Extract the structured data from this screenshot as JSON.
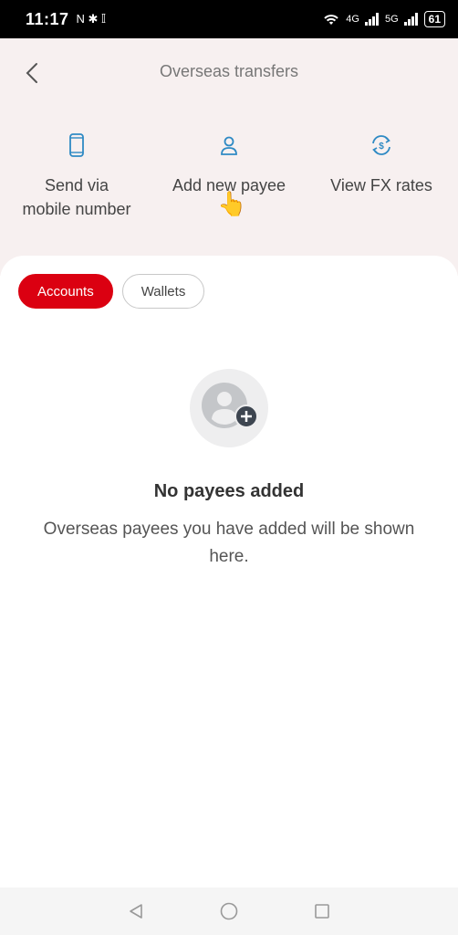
{
  "status_bar": {
    "time": "11:17",
    "left_icons": "N ✱ 𝕀",
    "net1": "4G",
    "net2": "5G",
    "battery": "61"
  },
  "header": {
    "title": "Overseas transfers"
  },
  "actions": [
    {
      "label_line1": "Send via",
      "label_line2": "mobile number",
      "icon": "phone-icon"
    },
    {
      "label_line1": "Add new payee",
      "label_line2": "",
      "icon": "person-icon"
    },
    {
      "label_line1": "View FX rates",
      "label_line2": "",
      "icon": "fx-icon"
    }
  ],
  "tabs": {
    "accounts": "Accounts",
    "wallets": "Wallets"
  },
  "empty_state": {
    "title": "No payees added",
    "description": "Overseas payees you have added will be shown here."
  },
  "colors": {
    "accent": "#db0011",
    "icon_blue": "#2f8ac4"
  }
}
